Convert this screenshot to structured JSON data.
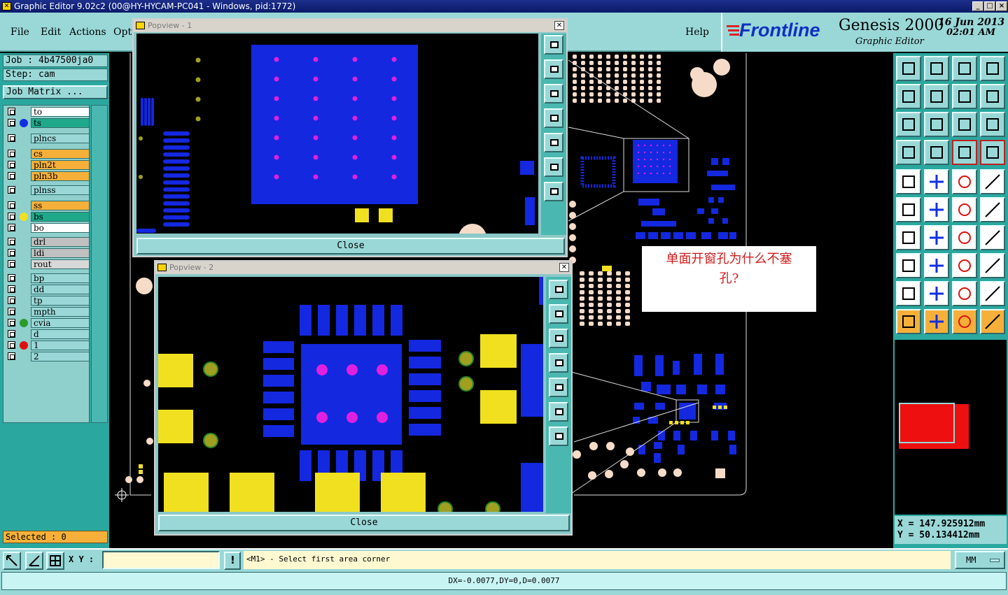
{
  "window": {
    "title": "Graphic Editor 9.02c2 (00@HY-HYCAM-PC041 - Windows, pid:1772)"
  },
  "menu": {
    "items": [
      "File",
      "Edit",
      "Actions",
      "Opti"
    ],
    "help": "Help"
  },
  "brand": {
    "logo": "Frontline",
    "product": "Genesis 2000",
    "subtitle": "Graphic Editor",
    "date": "16 Jun 2013",
    "time": "02:01 AM"
  },
  "job": {
    "job_label": "Job : 4b47500ja0",
    "step_label": "Step: cam",
    "matrix_button": "Job Matrix ..."
  },
  "layers": [
    {
      "name": "to",
      "color": "#ffffff",
      "dot": ""
    },
    {
      "name": "ts",
      "color": "#1fa88a",
      "dot": "#1030e0"
    },
    {
      "name": "plncs",
      "color": "#9ad8d8",
      "dot": ""
    },
    {
      "name": "cs",
      "color": "#f6b03a",
      "dot": ""
    },
    {
      "name": "pln2t",
      "color": "#f6b03a",
      "dot": ""
    },
    {
      "name": "pln3b",
      "color": "#f6b03a",
      "dot": ""
    },
    {
      "name": "plnss",
      "color": "#9ad8d8",
      "dot": ""
    },
    {
      "name": "ss",
      "color": "#f6b03a",
      "dot": ""
    },
    {
      "name": "bs",
      "color": "#1fa88a",
      "dot": "#f0e020"
    },
    {
      "name": "bo",
      "color": "#ffffff",
      "dot": ""
    },
    {
      "name": "drl",
      "color": "#c0c0c0",
      "dot": ""
    },
    {
      "name": "ldi",
      "color": "#c0c0c0",
      "dot": ""
    },
    {
      "name": "rout",
      "color": "#d8d8d8",
      "dot": ""
    },
    {
      "name": "bp",
      "color": "#9ad8d8",
      "dot": ""
    },
    {
      "name": "dd",
      "color": "#9ad8d8",
      "dot": ""
    },
    {
      "name": "tp",
      "color": "#9ad8d8",
      "dot": ""
    },
    {
      "name": "mpth",
      "color": "#9ad8d8",
      "dot": ""
    },
    {
      "name": "cvia",
      "color": "#9ad8d8",
      "dot": "#2a9a2a"
    },
    {
      "name": "d",
      "color": "#9ad8d8",
      "dot": ""
    },
    {
      "name": "1",
      "color": "#9ad8d8",
      "dot": "#e01010"
    },
    {
      "name": "2",
      "color": "#9ad8d8",
      "dot": ""
    }
  ],
  "selected": "Selected : 0",
  "popups": [
    {
      "title": "Popview - 1",
      "close_label": "Close"
    },
    {
      "title": "Popview - 2",
      "close_label": "Close"
    }
  ],
  "annotation": {
    "line1": "单面开窗孔为什么不塞",
    "line2": "孔?"
  },
  "coords": {
    "x": "X  =  147.925912mm",
    "y": "Y  =  50.134412mm"
  },
  "command": {
    "xy_label": "X Y :",
    "xy_value": "",
    "prompt": "<M1> - Select first area corner",
    "units": "MM"
  },
  "status": {
    "text": "DX=-0.0077,DY=0,D=0.0077"
  },
  "colors": {
    "copper_blue": "#1428e0",
    "pad_yellow": "#f0e020",
    "via_magenta": "#e020e0",
    "pad_peach": "#f6dcc8",
    "panel_teal": "#2aa8a0",
    "button_cyan": "#9ad8d8"
  },
  "toolbar_icons": [
    "zoom-home-icon",
    "zoom-prev-icon",
    "home-view-icon",
    "split-view-icon",
    "pan-left-icon",
    "pan-right-icon",
    "swap-icon",
    "snap-icon",
    "fit-icon",
    "center-icon",
    "scale-1-2-icon",
    "help-query-icon",
    "ruler-icon",
    "grid-icon",
    "feature-select-icon",
    "feature-select-alt-icon",
    "add-pad-icon",
    "add-line-icon",
    "measure-icon",
    "frame-icon",
    "node-icon",
    "cross-icon",
    "connect-icon",
    "connect-alt-icon",
    "angle-icon",
    "slash-icon",
    "rotate-icon",
    "mirror-icon",
    "select-rect-icon",
    "select-line-icon",
    "dimension-icon",
    "group-icon",
    "triangle-icon",
    "triangle-edit-icon",
    "arc-icon",
    "arc-edit-icon",
    "pointer-icon",
    "pointer-box-icon",
    "pointer-alt-icon",
    "route-icon"
  ]
}
